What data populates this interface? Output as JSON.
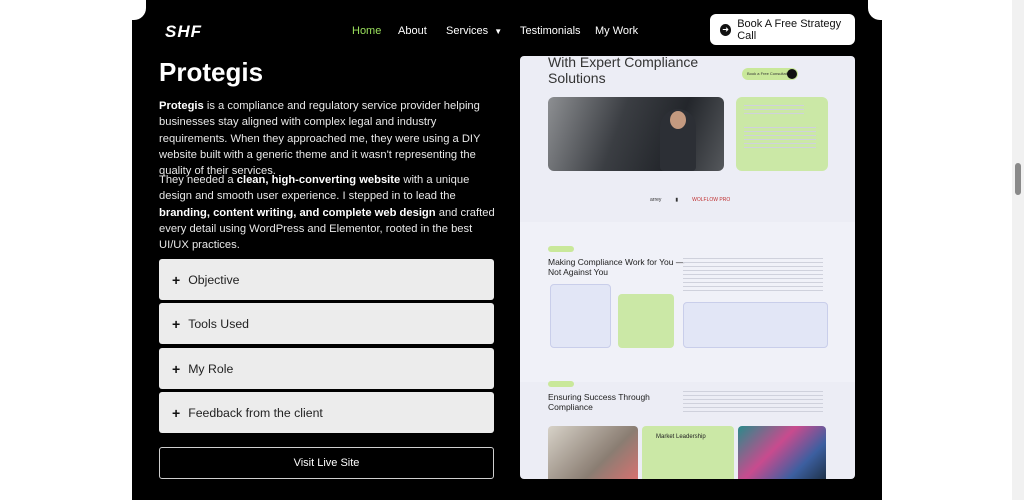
{
  "logo": "SHF",
  "nav": [
    {
      "label": "Home",
      "active": true
    },
    {
      "label": "About"
    },
    {
      "label": "Services"
    },
    {
      "label": "Testimonials"
    },
    {
      "label": "My Work"
    }
  ],
  "cta_label": "Book A Free Strategy Call",
  "project": {
    "title": "Protegis",
    "p1_bold": "Protegis",
    "p1_rest": " is a compliance and regulatory service provider helping businesses stay aligned with complex legal and industry requirements. When they approached me, they were using a DIY website built with a generic theme and it wasn't representing the quality of their services.",
    "p2_a": "They needed a ",
    "p2_b": "clean, high-converting website",
    "p2_c": " with a unique design and smooth user experience. I stepped in to lead the ",
    "p2_d": "branding, content writing, and complete web design",
    "p2_e": " and crafted every detail using WordPress and Elementor, rooted in the best UI/UX practices."
  },
  "accordion": [
    "Objective",
    "Tools Used",
    "My Role",
    "Feedback from the client"
  ],
  "visit_label": "Visit Live Site",
  "preview": {
    "hero_title": "With Expert Compliance Solutions",
    "pill": "Book a Free Consultation",
    "section2_title": "Making Compliance Work for You —Not Against You",
    "section3_title": "Ensuring Success Through Compliance",
    "market_card": "Market Leadership",
    "logos": [
      "arrey",
      "▮",
      "WOLFLOW PRO"
    ]
  },
  "colors": {
    "accent": "#9be15d",
    "frame": "#000000",
    "lime": "#cbe8a6"
  }
}
